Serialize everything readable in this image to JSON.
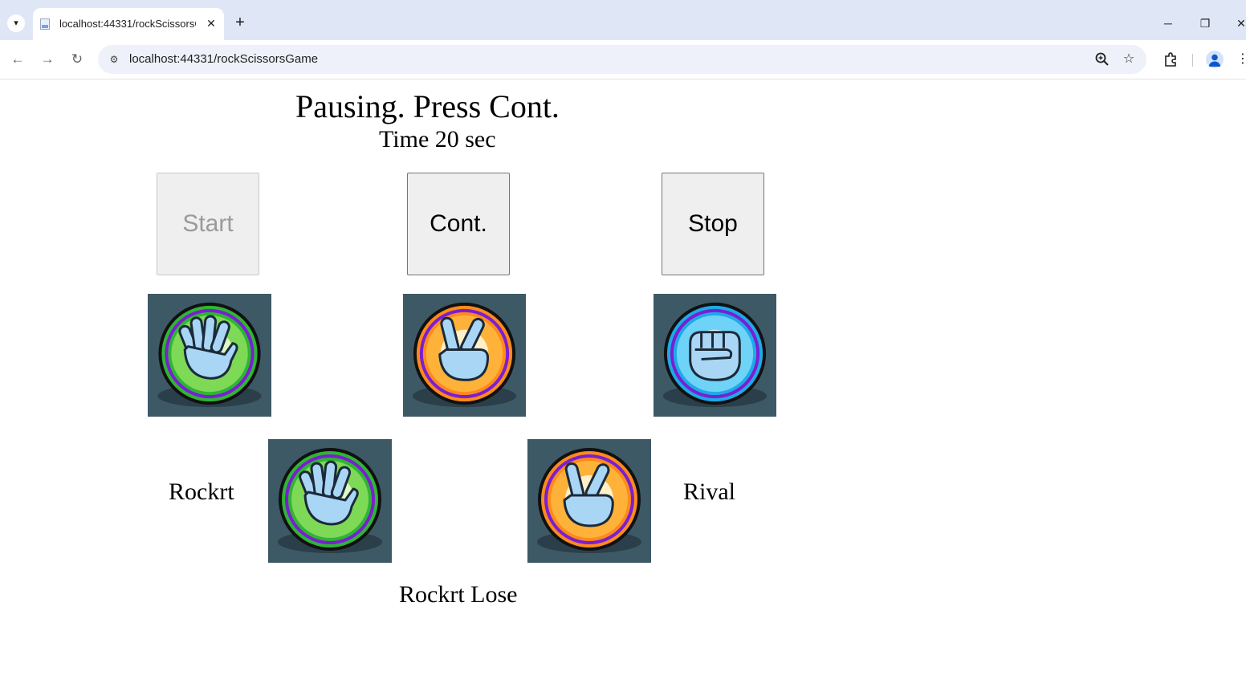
{
  "browser": {
    "tab_title": "localhost:44331/rockScissorsGame",
    "tab_close": "✕",
    "new_tab": "+",
    "url": "localhost:44331/rockScissorsGame"
  },
  "game": {
    "status_message": "Pausing. Press Cont.",
    "timer_text": "Time 20 sec",
    "buttons": {
      "start_label": "Start",
      "start_enabled": false,
      "continue_label": "Cont.",
      "stop_label": "Stop"
    },
    "choices": [
      "paper",
      "scissors",
      "rock"
    ],
    "player": {
      "name": "Rockrt",
      "hand": "paper"
    },
    "rival": {
      "name": "Rival",
      "hand": "scissors"
    },
    "result_text": "Rockrt Lose"
  },
  "colors": {
    "tile_background": "#3e5966",
    "paper_ring": "#2fb534",
    "scissors_ring": "#ff8a1c",
    "rock_ring": "#1ea9e8",
    "hand_fill": "#a9d6f5"
  },
  "icons": {
    "tab_menu": "chevron-down-icon",
    "back": "back-arrow-icon",
    "forward": "forward-arrow-icon",
    "reload": "reload-icon",
    "site_info": "site-info-icon",
    "zoom": "zoom-icon",
    "bookmark": "star-icon",
    "extensions": "puzzle-icon",
    "profile": "avatar-icon",
    "menu": "kebab-menu-icon"
  }
}
